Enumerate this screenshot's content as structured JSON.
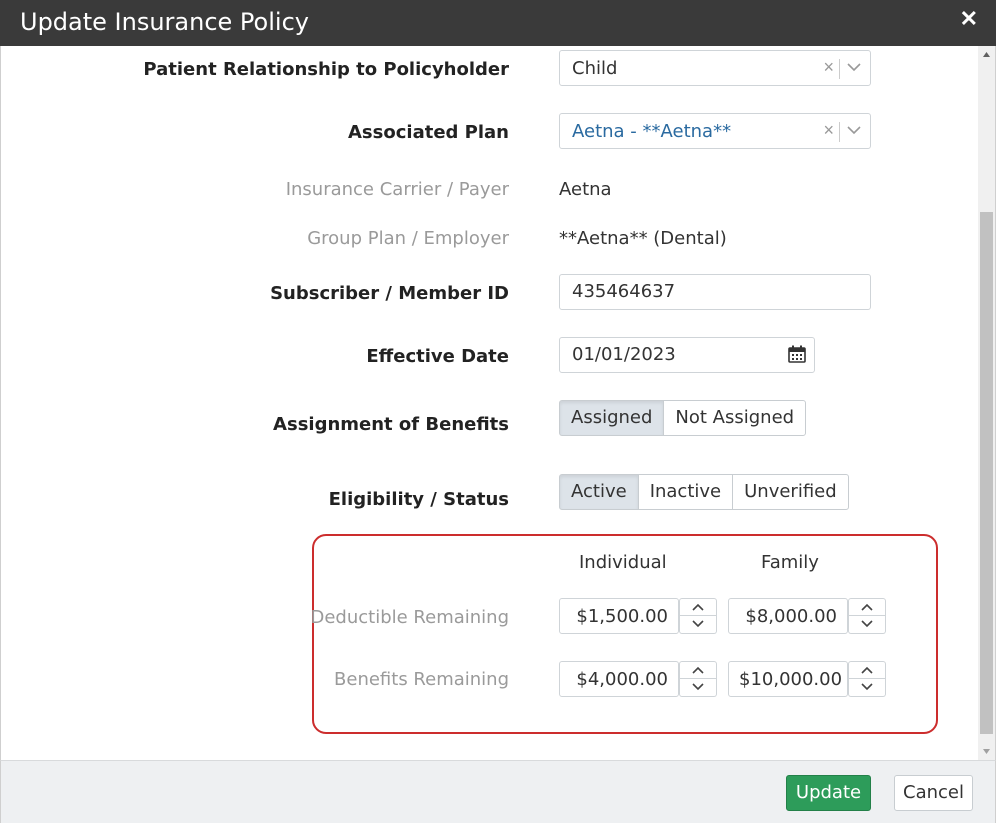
{
  "dialog": {
    "title": "Update Insurance Policy"
  },
  "fields": {
    "relationship": {
      "label": "Patient Relationship to Policyholder",
      "value": "Child"
    },
    "plan": {
      "label": "Associated Plan",
      "value": "Aetna - **Aetna**",
      "accent": "#2a6aa0"
    },
    "carrier": {
      "label": "Insurance Carrier / Payer",
      "value": "Aetna"
    },
    "group": {
      "label": "Group Plan / Employer",
      "value": "**Aetna** (Dental)"
    },
    "member_id": {
      "label": "Subscriber / Member ID",
      "value": "435464637"
    },
    "effective_date": {
      "label": "Effective Date",
      "value": "01/01/2023",
      "icon": "calendar-icon"
    },
    "assignment": {
      "label": "Assignment of Benefits",
      "options": [
        "Assigned",
        "Not Assigned"
      ],
      "selected": "Assigned"
    },
    "eligibility": {
      "label": "Eligibility / Status",
      "options": [
        "Active",
        "Inactive",
        "Unverified"
      ],
      "selected": "Active"
    }
  },
  "amounts": {
    "col_individual": "Individual",
    "col_family": "Family",
    "deductible": {
      "label": "Deductible Remaining",
      "individual": "$1,500.00",
      "family": "$8,000.00"
    },
    "benefits": {
      "label": "Benefits Remaining",
      "individual": "$4,000.00",
      "family": "$10,000.00"
    }
  },
  "footer": {
    "update_label": "Update",
    "cancel_label": "Cancel",
    "update_color": "#2d9c5a"
  }
}
